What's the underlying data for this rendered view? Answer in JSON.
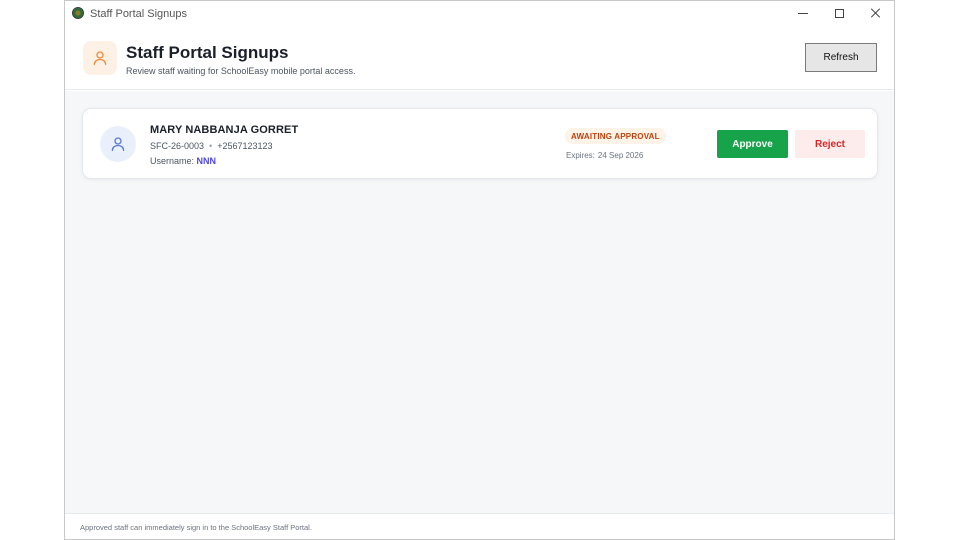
{
  "window": {
    "title": "Staff Portal Signups"
  },
  "header": {
    "title": "Staff Portal Signups",
    "subtitle": "Review staff waiting for SchoolEasy mobile portal access.",
    "icon": "user-icon",
    "refresh_label": "Refresh"
  },
  "signups": [
    {
      "name": "MARY NABBANJA GORRET",
      "staff_id": "SFC-26-0003",
      "separator": "•",
      "phone": "+2567123123",
      "username_label": "Username:",
      "username": "NNN",
      "status": "AWAITING APPROVAL",
      "expires_label": "Expires:",
      "expires_date": "24 Sep 2026",
      "approve_label": "Approve",
      "reject_label": "Reject",
      "avatar_icon": "user-icon"
    }
  ],
  "footer": {
    "text": "Approved staff can immediately sign in to the SchoolEasy Staff Portal."
  },
  "colors": {
    "accent_orange": "#f08a3c",
    "approve_green": "#16a34a",
    "reject_red": "#dc2626",
    "username_indigo": "#4f46e5",
    "status_orange": "#c2410c"
  }
}
